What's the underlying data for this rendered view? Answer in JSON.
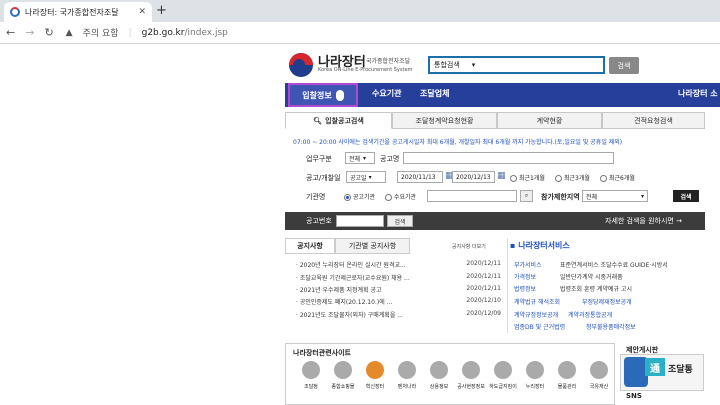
{
  "browser": {
    "tab_title": "나라장터: 국가종합전자조달",
    "url_warning": "주의 요함",
    "url_domain": "g2b.go.kr",
    "url_path": "/index.jsp"
  },
  "header": {
    "brand": "나라장터",
    "brand_sub": "국가종합전자조달",
    "brand_en": "Korea ON-Line E-Procurement System",
    "search_select": "통합검색",
    "search_button": "검색"
  },
  "nav": {
    "selected": "입찰정보",
    "items": [
      "수요기관",
      "조달업체"
    ],
    "right": "나라장터 소"
  },
  "search_tabs": [
    "입찰공고검색",
    "조달청계약요청현황",
    "계약현황",
    "견적요청검색"
  ],
  "notice": "07:00 ~ 20:00 사이에는 검색기간을 공고게시일자 최대 6개월, 개찰일자 최대 6개월 까지 가능합니다.(토,일요일 및 공휴일 제외)",
  "form": {
    "biz_label": "업무구분",
    "biz_value": "전체",
    "name_label": "공고명",
    "date_label": "공고/개찰일",
    "date_type": "공고일",
    "date_from": "2020/11/13",
    "date_to": "2020/12/13",
    "r1": "최근1개월",
    "r2": "최근3개월",
    "r3": "최근6개월",
    "org_label": "기관명",
    "org_r1": "공고기관",
    "org_r2": "수요기관",
    "region_label": "참가제한지역",
    "region_value": "전체",
    "search": "검색",
    "no_label": "공고번호",
    "no_search": "검색",
    "detail": "자세한 검색을 원하시면 →"
  },
  "notices": {
    "tab1": "공지사항",
    "tab2": "기관별 공지사항",
    "more": "공지사항 더보기",
    "rows": [
      {
        "t": "· 2020년 누리장터 온라인 실시간 원격교...",
        "d": "2020/12/11"
      },
      {
        "t": "· 조달교육원 기간제근로자(교수요원) 채용 ...",
        "d": "2020/12/11"
      },
      {
        "t": "· 2021년 우수제품 지정계획 공고",
        "d": "2020/12/11"
      },
      {
        "t": "· 공인인증제도 폐지(20.12.10.)에 ...",
        "d": "2020/12/10"
      },
      {
        "t": "· 2021년도 조달물자(외자) 구매계획을 ...",
        "d": "2020/12/09"
      }
    ]
  },
  "services": {
    "title": "나라장터서비스",
    "rows": [
      {
        "l": "부가서비스",
        "r": "표준연계서비스  조달수수료  GUIDE·시방서"
      },
      {
        "l": "가격정보",
        "r": "일반단가계약  시중거래품"
      },
      {
        "l": "법령정보",
        "r": "법령조회  훈령  계약예규  고시"
      }
    ],
    "extra": [
      "계약법규 해석조회",
      "부정당제재정보공개",
      "계약규정정보공개",
      "계약과정통합공개",
      "업종DB 및 근거법령",
      "청부불용품매각정보"
    ]
  },
  "related": {
    "title": "나라장터관련사이트",
    "items": [
      "조달청",
      "종합쇼핑몰",
      "혁신장터",
      "벤처나라",
      "상용정보",
      "공사현장정보",
      "하도급지킴이",
      "누리장터",
      "물품관리",
      "국유재산"
    ]
  },
  "sidebar": {
    "title": "제안게시판",
    "banner_icon": "通",
    "banner_text": "조달통",
    "sns": "SNS"
  }
}
